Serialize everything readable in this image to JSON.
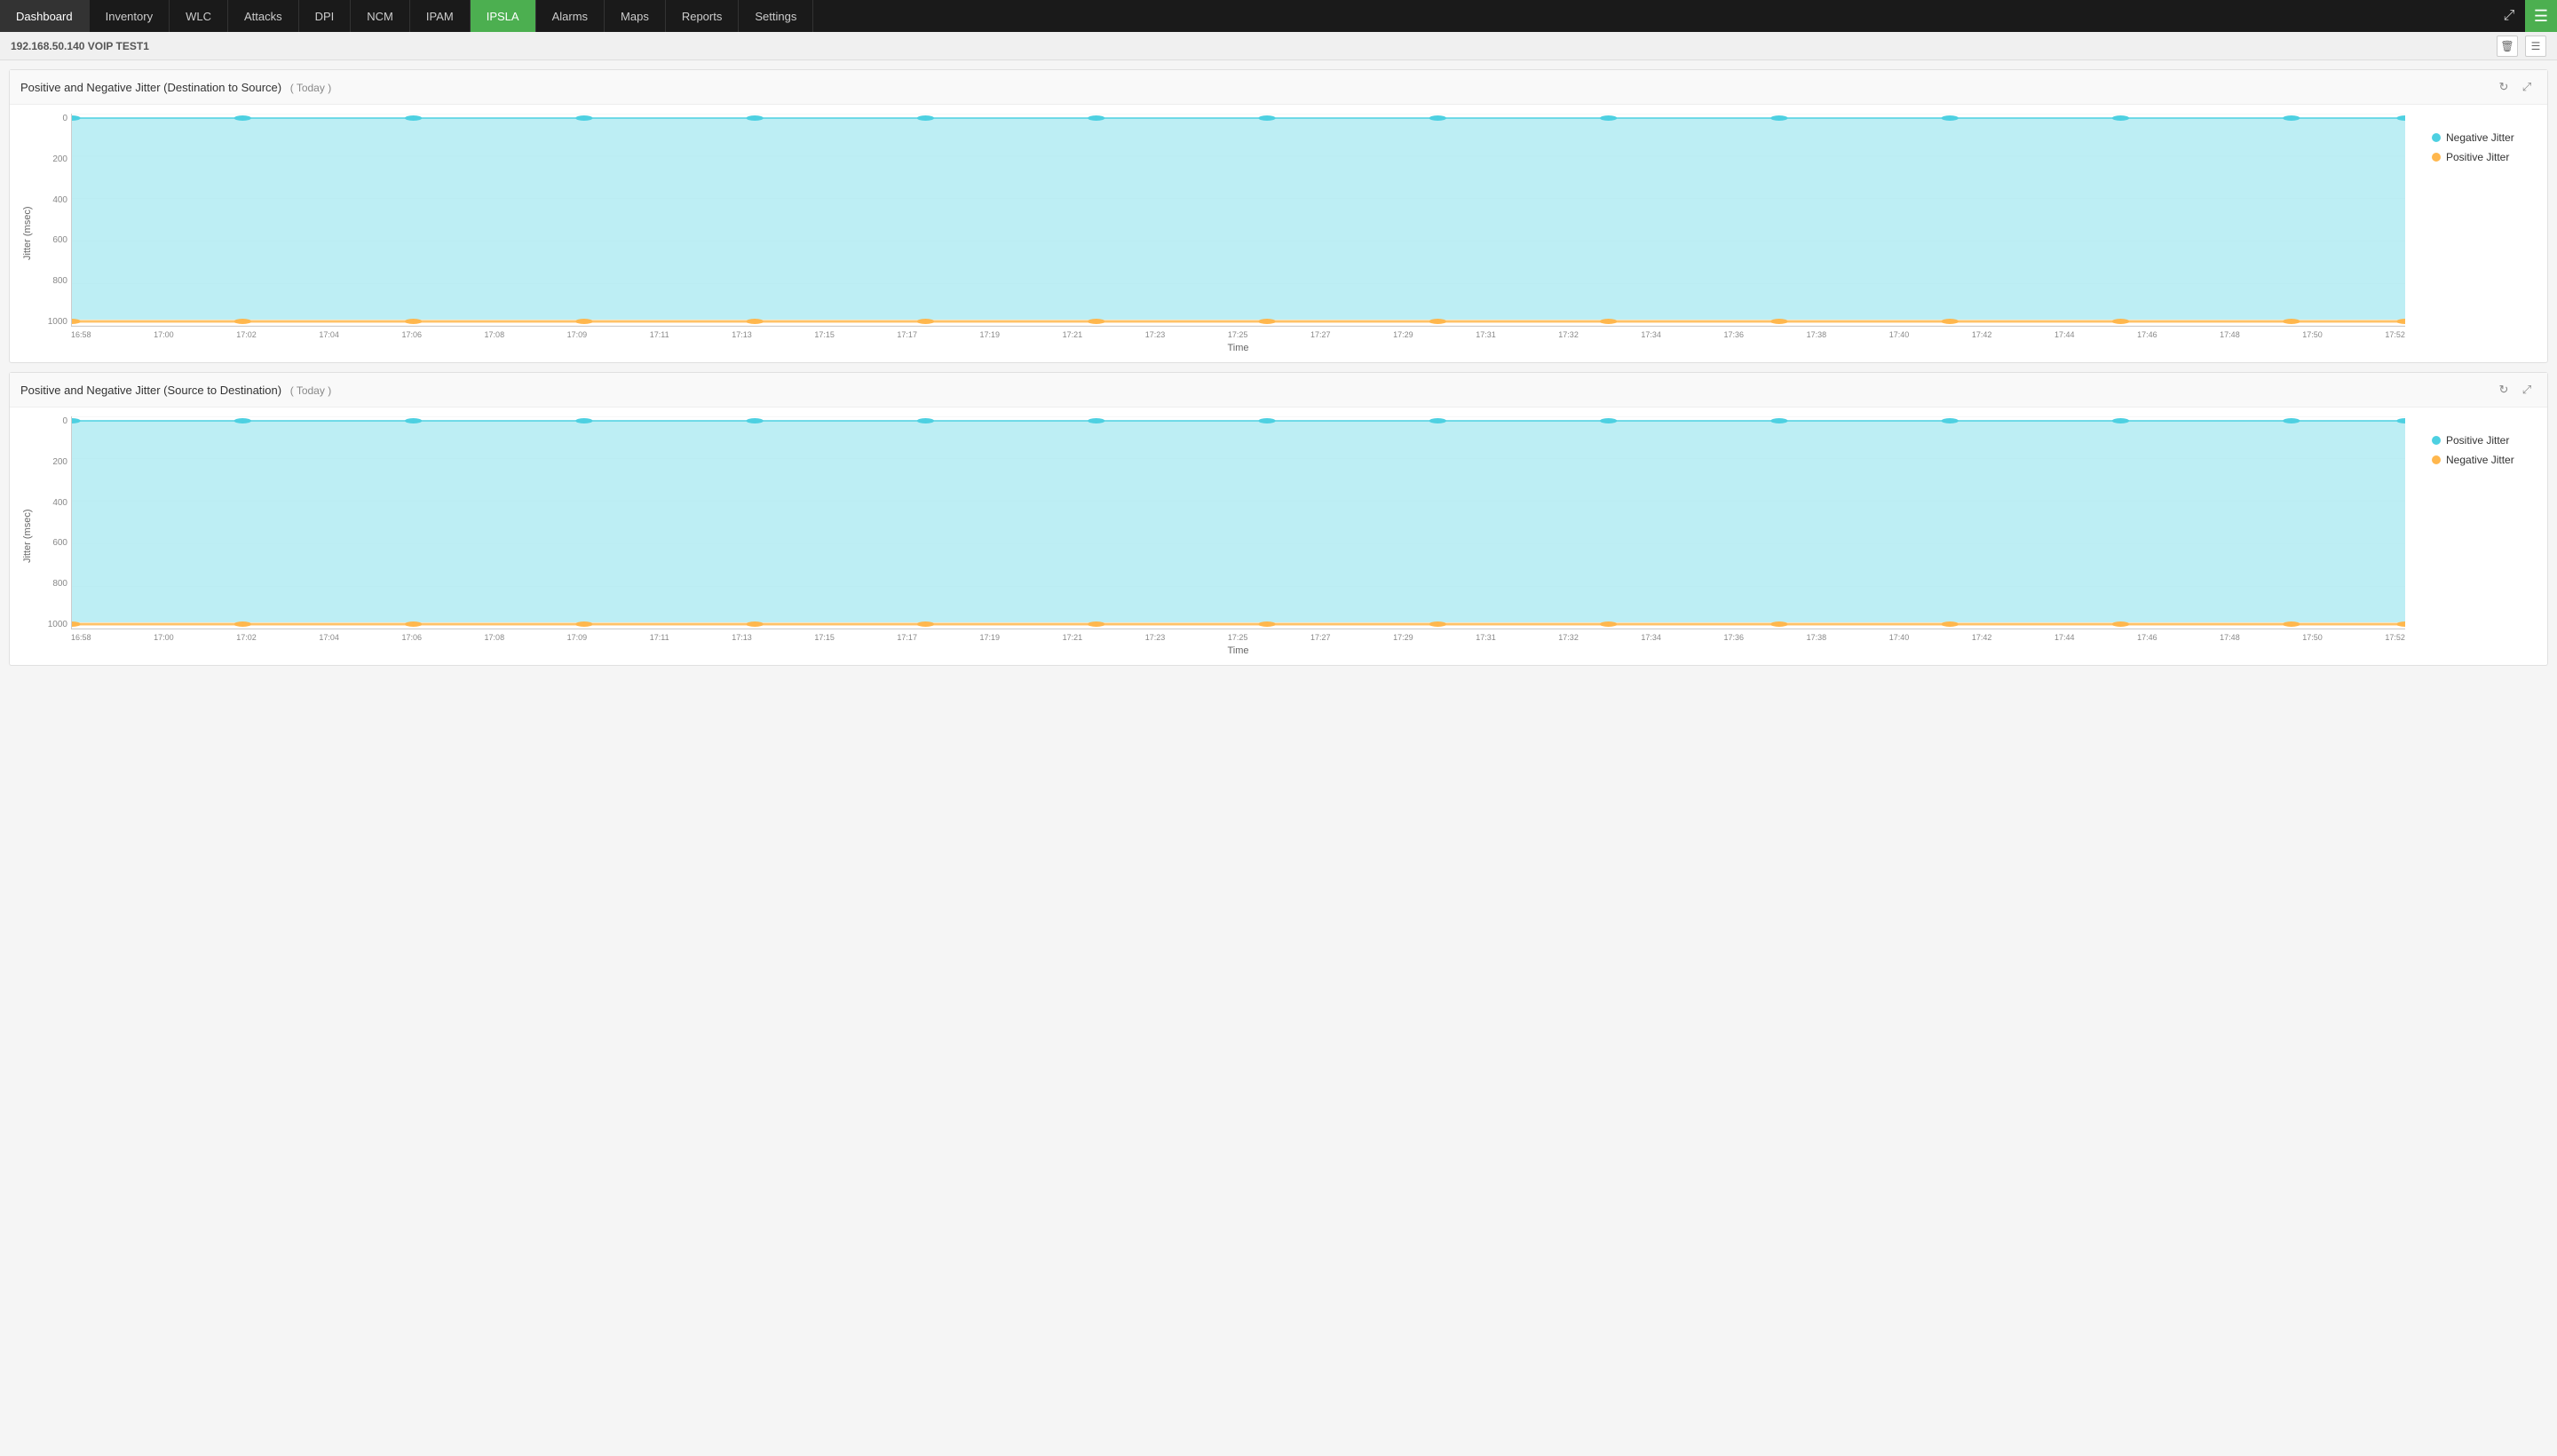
{
  "nav": {
    "items": [
      {
        "label": "Dashboard",
        "active": false
      },
      {
        "label": "Inventory",
        "active": false
      },
      {
        "label": "WLC",
        "active": false
      },
      {
        "label": "Attacks",
        "active": false
      },
      {
        "label": "DPI",
        "active": false
      },
      {
        "label": "NCM",
        "active": false
      },
      {
        "label": "IPAM",
        "active": false
      },
      {
        "label": "IPSLA",
        "active": true
      },
      {
        "label": "Alarms",
        "active": false
      },
      {
        "label": "Maps",
        "active": false
      },
      {
        "label": "Reports",
        "active": false
      },
      {
        "label": "Settings",
        "active": false
      }
    ],
    "expand_icon": "⤢",
    "menu_icon": "☰"
  },
  "sub_header": {
    "title": "192.168.50.140  VOIP TEST1",
    "delete_icon": "🗑",
    "settings_icon": "☰"
  },
  "chart1": {
    "title": "Positive and Negative Jitter (Destination to Source)",
    "subtitle": "( Today )",
    "refresh_icon": "↻",
    "resize_icon": "⤢",
    "y_axis_label": "Jitter (msec)",
    "x_axis_label": "Time",
    "y_ticks": [
      "0",
      "200",
      "400",
      "600",
      "800",
      "1000"
    ],
    "x_ticks": [
      "16:58",
      "17:00",
      "17:02",
      "17:04",
      "17:06",
      "17:08",
      "17:09",
      "17:11",
      "17:13",
      "17:15",
      "17:17",
      "17:19",
      "17:21",
      "17:23",
      "17:25",
      "17:27",
      "17:29",
      "17:31",
      "17:32",
      "17:34",
      "17:36",
      "17:38",
      "17:40",
      "17:42",
      "17:44",
      "17:46",
      "17:48",
      "17:50",
      "17:52"
    ],
    "legend": [
      {
        "label": "Negative Jitter",
        "color": "#4dd0e1"
      },
      {
        "label": "Positive Jitter",
        "color": "#ffb74d"
      }
    ],
    "negative_jitter_color": "#b2ebf2",
    "positive_jitter_color": "#ffe0b2",
    "negative_jitter_stroke": "#4dd0e1",
    "positive_jitter_stroke": "#ffb74d"
  },
  "chart2": {
    "title": "Positive and Negative Jitter (Source to Destination)",
    "subtitle": "( Today )",
    "refresh_icon": "↻",
    "resize_icon": "⤢",
    "y_axis_label": "Jitter (msec)",
    "x_axis_label": "Time",
    "y_ticks": [
      "0",
      "200",
      "400",
      "600",
      "800",
      "1000"
    ],
    "x_ticks": [
      "16:58",
      "17:00",
      "17:02",
      "17:04",
      "17:06",
      "17:08",
      "17:09",
      "17:11",
      "17:13",
      "17:15",
      "17:17",
      "17:19",
      "17:21",
      "17:23",
      "17:25",
      "17:27",
      "17:29",
      "17:31",
      "17:32",
      "17:34",
      "17:36",
      "17:38",
      "17:40",
      "17:42",
      "17:44",
      "17:46",
      "17:48",
      "17:50",
      "17:52"
    ],
    "legend": [
      {
        "label": "Positive Jitter",
        "color": "#4dd0e1"
      },
      {
        "label": "Negative Jitter",
        "color": "#ffb74d"
      }
    ],
    "negative_jitter_color": "#b2ebf2",
    "positive_jitter_color": "#ffe0b2",
    "negative_jitter_stroke": "#4dd0e1",
    "positive_jitter_stroke": "#ffb74d"
  }
}
